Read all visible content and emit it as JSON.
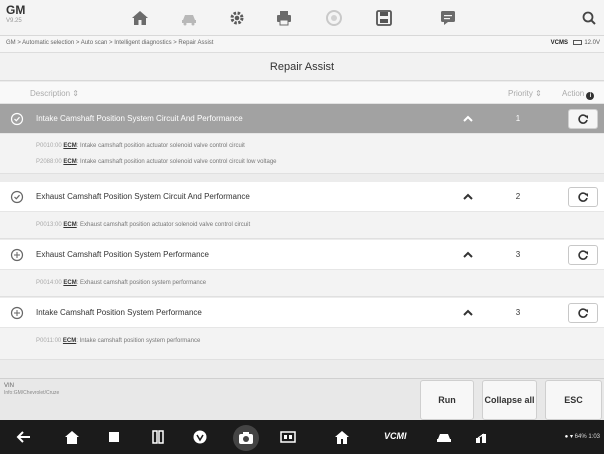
{
  "header": {
    "brand": "GM",
    "brand_sub": "V9.25",
    "toolbar_icons": [
      "home-icon",
      "vehicle-swap-icon",
      "settings-icon",
      "print-icon",
      "help-icon",
      "save-icon",
      "messages-icon",
      "search-icon"
    ]
  },
  "breadcrumb": {
    "path": "GM > Automatic selection > Auto scan > Intelligent diagnostics > Repair Assist",
    "vin_label": "VCMS",
    "voltage": "12.0V"
  },
  "page": {
    "title": "Repair Assist"
  },
  "table": {
    "columns": {
      "description": "Description",
      "sort_glyph": "⇕",
      "priority": "Priority",
      "action": "Action"
    },
    "rows": [
      {
        "title": "Intake Camshaft Position System Circuit And Performance",
        "priority": "1",
        "selected": true,
        "details": [
          {
            "code": "P0010:00",
            "module": "ECM",
            "text": ": Intake camshaft position actuator solenoid valve control circuit"
          },
          {
            "code": "P2088:00",
            "module": "ECM",
            "text": ": Intake camshaft position actuator solenoid valve control circuit low voltage"
          }
        ]
      },
      {
        "title": "Exhaust Camshaft Position System Circuit And Performance",
        "priority": "2",
        "selected": false,
        "details": [
          {
            "code": "P0013:00",
            "module": "ECM",
            "text": ": Exhaust camshaft position actuator solenoid valve control circuit"
          }
        ]
      },
      {
        "title": "Exhaust Camshaft Position System Performance",
        "priority": "3",
        "selected": false,
        "details": [
          {
            "code": "P0014:00",
            "module": "ECM",
            "text": ": Exhaust camshaft position system performance"
          }
        ]
      },
      {
        "title": "Intake Camshaft Position System Performance",
        "priority": "3",
        "selected": false,
        "details": [
          {
            "code": "P0011:00",
            "module": "ECM",
            "text": ": Intake camshaft position system performance"
          }
        ]
      }
    ]
  },
  "footer": {
    "vin_label": "VIN",
    "vehicle": "Info:GM/Chevrolet/Cruze",
    "buttons": {
      "run": "Run",
      "collapse": "Collapse all",
      "esc": "ESC"
    }
  },
  "navbar": {
    "vcmi": "VCMI",
    "status": "64% 1:03"
  },
  "colors": {
    "selected_row": "#a2a2a2",
    "navbar": "#1b1b1b"
  }
}
